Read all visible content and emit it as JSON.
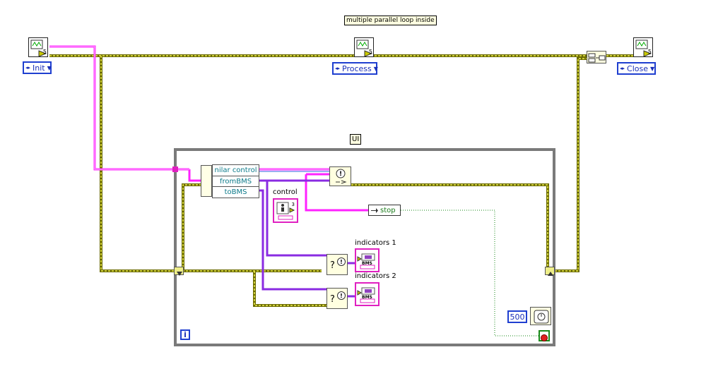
{
  "title_label": "multiple parallel loop inside",
  "loop_label": "UI",
  "states": {
    "init": "Init",
    "process": "Process",
    "close": "Close"
  },
  "vi_icon_number": "5",
  "unbundle": {
    "items": [
      "nilar control",
      "fromBMS",
      "toBMS"
    ]
  },
  "control_label": "control",
  "control_number": "3",
  "stop_label": "stop",
  "indicators": {
    "one": "indicators 1",
    "two": "indicators 2",
    "icon_text": "BMS"
  },
  "wait_ms": "500",
  "iteration_symbol": "i",
  "case_symbols": {
    "question": "?",
    "exclaim": "!"
  },
  "colors": {
    "cluster_wire": "#ff22ff",
    "error_wire": "#c8c800",
    "enum_wire": "#2050e0",
    "loop_frame": "#7a7a7a",
    "stop_wire": "#1a8a1a"
  },
  "icons": [
    "waveform-vi-icon",
    "bundle-icon",
    "wait-icon",
    "stop-icon",
    "error-icon",
    "cluster-indicator-icon"
  ]
}
